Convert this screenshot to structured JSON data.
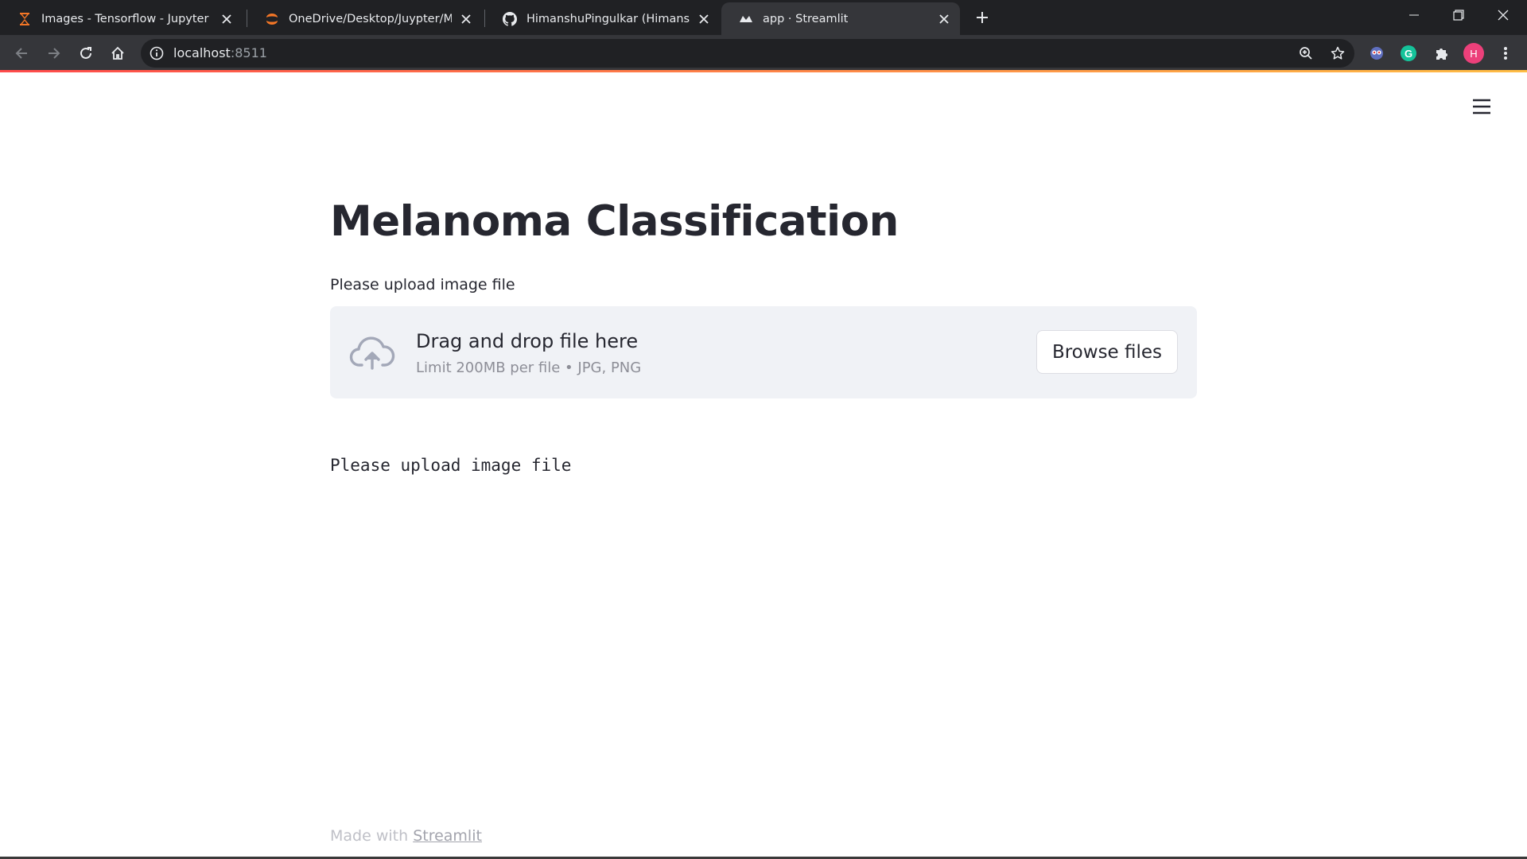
{
  "browser": {
    "tabs": [
      {
        "title": "Images - Tensorflow - Jupyter No",
        "icon": "jupyter-icon",
        "active": false
      },
      {
        "title": "OneDrive/Desktop/Juypter/Melan",
        "icon": "jupyter-logo-icon",
        "active": false
      },
      {
        "title": "HimanshuPingulkar (Himanshu P",
        "icon": "github-icon",
        "active": false
      },
      {
        "title": "app · Streamlit",
        "icon": "streamlit-icon",
        "active": true
      }
    ],
    "url_host": "localhost",
    "url_port": ":8511",
    "profile_initial": "H",
    "grammarly_initial": "G"
  },
  "app": {
    "title": "Melanoma Classification",
    "uploader_label": "Please upload image file",
    "dropzone": {
      "title": "Drag and drop file here",
      "limit": "Limit 200MB per file • JPG, PNG",
      "browse_label": "Browse files"
    },
    "output_text": "Please upload image file",
    "footer": {
      "prefix": "Made with ",
      "link": "Streamlit"
    }
  },
  "colors": {
    "primary_text": "#262730",
    "dropzone_bg": "#f0f2f6",
    "decoration_start": "#ff4b4b",
    "decoration_end": "#ffbd45",
    "chrome_dark": "#202124",
    "chrome_toolbar": "#35363a"
  }
}
